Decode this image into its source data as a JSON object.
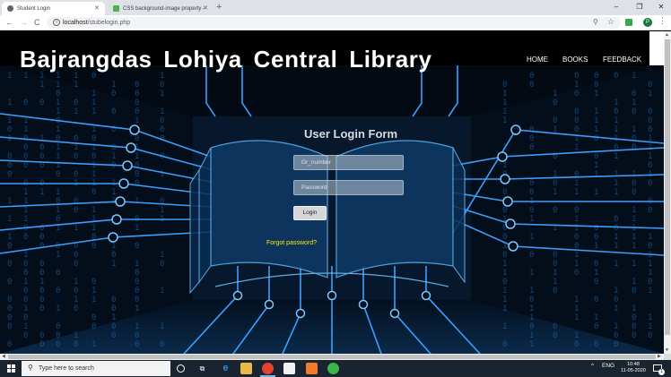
{
  "browser": {
    "tabs": [
      {
        "title": "Student Login",
        "active": true
      },
      {
        "title": "CSS background-image property -",
        "active": false
      }
    ],
    "new_tab": "+",
    "window_controls": {
      "minimize": "–",
      "restore": "❐",
      "close": "✕"
    },
    "nav": {
      "back": "←",
      "forward": "→",
      "reload": "C"
    },
    "url_host": "localhost",
    "url_path": "/stubelogin.php",
    "profile_initial": "P",
    "menu": "⋮"
  },
  "site": {
    "title": "Bajrangdas Lohiya Central Library",
    "nav": [
      "HOME",
      "BOOKS",
      "FEEDBACK"
    ]
  },
  "login_form": {
    "title": "User Login Form",
    "gr_placeholder": "Gr_number",
    "password_placeholder": "Password",
    "button_label": "Login",
    "forgot_link": "Forgot password?"
  },
  "taskbar": {
    "search_placeholder": "Type here to search",
    "tray_caret": "^",
    "language": "ENG",
    "time": "10:48",
    "date": "11-05-2020",
    "notification_count": "1"
  },
  "colors": {
    "forgot_link": "#ffea00",
    "circuit": "#3aa0ff",
    "header_bg": "#000000",
    "taskbar_bg": "#1a2430"
  }
}
